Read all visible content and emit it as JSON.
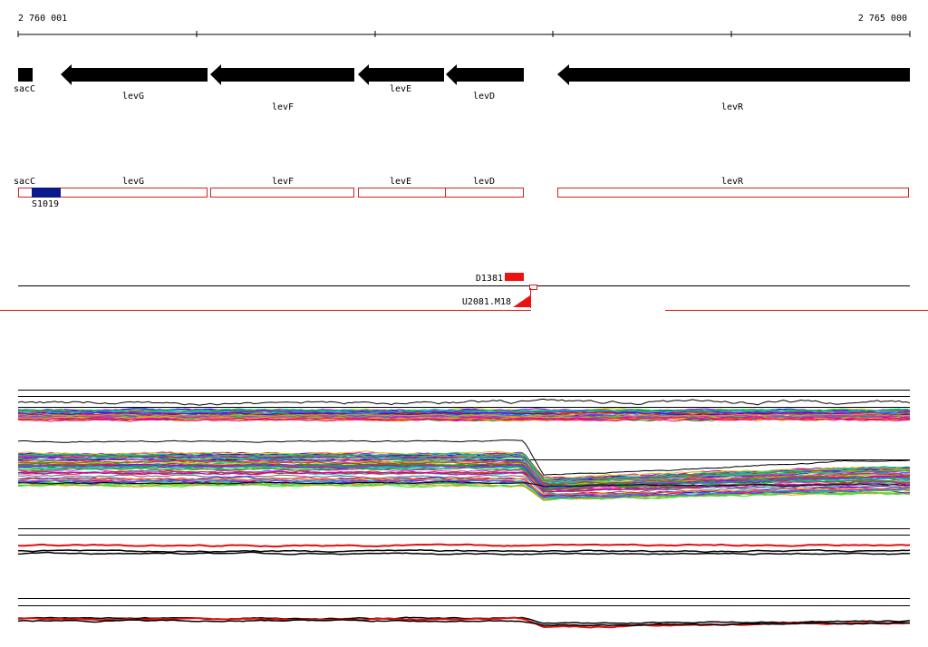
{
  "ruler": {
    "start_label": "2 760 001",
    "end_label": "2 765 000"
  },
  "colors": {
    "gene_arrow": "#000000",
    "feature_outline": "#d42020",
    "feature_fill": "#ffffff",
    "s_feature": "#0a1a8c",
    "probe": "#ee1111",
    "track_line": "#000000",
    "highlight_line": "#e01010"
  },
  "genes": [
    {
      "name": "sacC",
      "strand": "+"
    },
    {
      "name": "levG",
      "strand": "-"
    },
    {
      "name": "levF",
      "strand": "-"
    },
    {
      "name": "levE",
      "strand": "-"
    },
    {
      "name": "levD",
      "strand": "-"
    },
    {
      "name": "levR",
      "strand": "-"
    }
  ],
  "features": [
    {
      "name": "sacC"
    },
    {
      "name": "levG"
    },
    {
      "name": "levF"
    },
    {
      "name": "levE"
    },
    {
      "name": "levD"
    },
    {
      "name": "levR"
    }
  ],
  "s_feature": {
    "name": "S1019"
  },
  "probes": [
    {
      "name": "D1381"
    },
    {
      "name": "U2081.M18"
    }
  ]
}
